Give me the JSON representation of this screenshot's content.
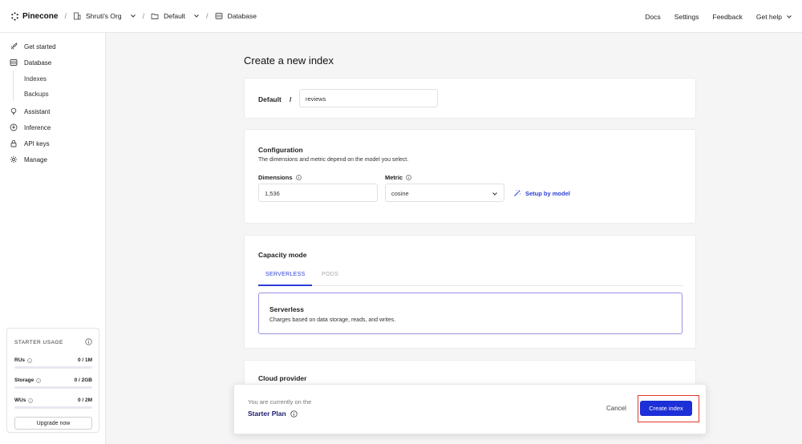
{
  "topbar": {
    "brand": "Pinecone",
    "breadcrumbs": [
      "Shruti's Org",
      "Default",
      "Database"
    ],
    "nav": [
      "Docs",
      "Settings",
      "Feedback",
      "Get help"
    ]
  },
  "sidebar": {
    "items": [
      {
        "label": "Get started",
        "icon": "rocket-icon"
      },
      {
        "label": "Database",
        "icon": "database-icon"
      },
      {
        "label": "Indexes"
      },
      {
        "label": "Backups"
      },
      {
        "label": "Assistant",
        "icon": "lightbulb-icon"
      },
      {
        "label": "Inference",
        "icon": "inference-icon"
      },
      {
        "label": "API keys",
        "icon": "lock-icon"
      },
      {
        "label": "Manage",
        "icon": "gear-icon"
      }
    ],
    "usage": {
      "title": "STARTER USAGE",
      "rows": [
        {
          "label": "RUs",
          "value": "0 / 1M",
          "fill": 0
        },
        {
          "label": "Storage",
          "value": "0 / 2GB",
          "fill": 0
        },
        {
          "label": "WUs",
          "value": "0 / 2M",
          "fill": 0
        }
      ],
      "upgrade_label": "Upgrade now"
    }
  },
  "main": {
    "title": "Create a new index",
    "project": {
      "label": "Default",
      "separator": "/",
      "index_name": "reviews"
    },
    "configuration": {
      "title": "Configuration",
      "description": "The dimensions and metric depend on the model you select.",
      "dimensions_label": "Dimensions",
      "dimensions_value": "1,536",
      "metric_label": "Metric",
      "metric_value": "cosine",
      "setup_label": "Setup by model"
    },
    "capacity": {
      "title": "Capacity mode",
      "tabs": [
        "SERVERLESS",
        "PODS"
      ],
      "option_title": "Serverless",
      "option_desc": "Charges based on data storage, reads, and writes."
    },
    "cloud": {
      "title": "Cloud provider"
    }
  },
  "footer": {
    "plan_prefix": "You are currently on the",
    "plan_name": "Starter Plan",
    "cancel_label": "Cancel",
    "create_label": "Create index"
  },
  "colors": {
    "accent": "#1d2fd6",
    "highlight": "#e23a2c"
  }
}
